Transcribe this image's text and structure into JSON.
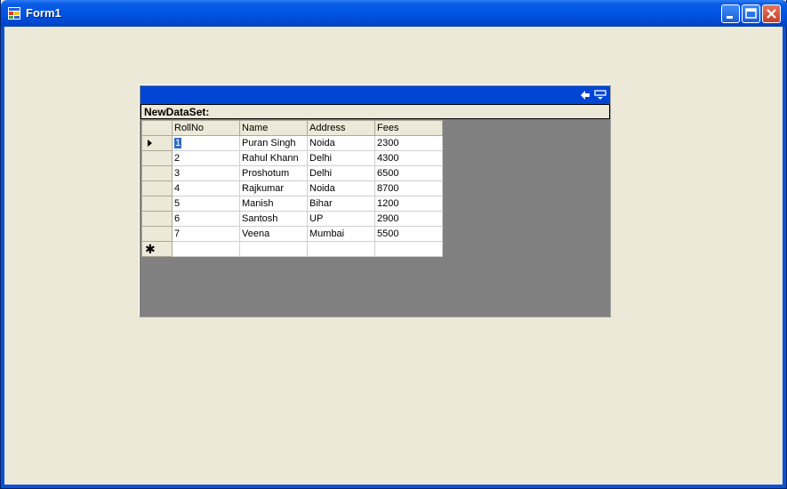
{
  "window": {
    "title": "Form1"
  },
  "datagrid": {
    "caption_icons": [
      "back-arrow-icon",
      "toggle-parent-rows-icon"
    ],
    "parent_label": "NewDataSet:",
    "columns": [
      "RollNo",
      "Name",
      "Address",
      "Fees"
    ],
    "rows": [
      [
        "1",
        "Puran Singh",
        "Noida",
        "2300"
      ],
      [
        "2",
        "Rahul Khann",
        "Delhi",
        "4300"
      ],
      [
        "3",
        "Proshotum",
        "Delhi",
        "6500"
      ],
      [
        "4",
        "Rajkumar",
        "Noida",
        "8700"
      ],
      [
        "5",
        "Manish",
        "Bihar",
        "1200"
      ],
      [
        "6",
        "Santosh",
        "UP",
        "2900"
      ],
      [
        "7",
        "Veena",
        "Mumbai",
        "5500"
      ]
    ],
    "new_row_marker": "✱"
  },
  "colors": {
    "titlebar": "#0054e3",
    "caption": "#0046d5",
    "background": "#ece9d8",
    "grid_bg": "#808080",
    "selection": "#316ac5"
  }
}
